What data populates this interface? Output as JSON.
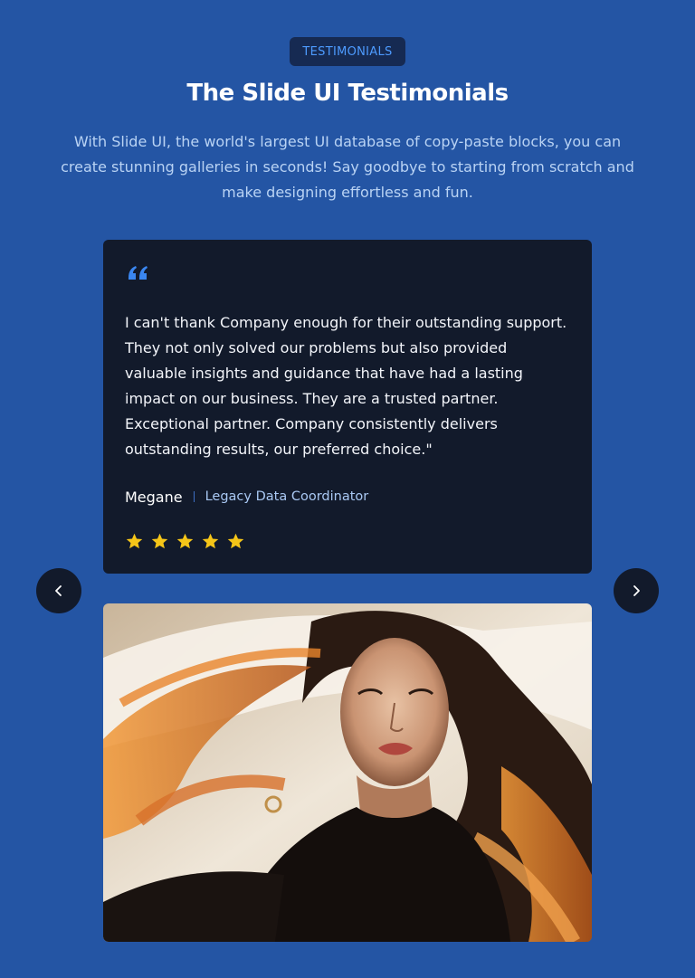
{
  "header": {
    "eyebrow": "TESTIMONIALS",
    "title": "The Slide UI Testimonials",
    "subtitle": "With Slide UI, the world's largest UI database of copy-paste blocks, you can create stunning galleries in seconds! Say goodbye to starting from scratch and make designing effortless and fun."
  },
  "testimonial": {
    "quote_icon": "quote-icon",
    "text": "I can't thank Company enough for their outstanding support. They not only solved our problems but also provided valuable insights and guidance that have had a lasting impact on our business. They are a trusted partner. Exceptional partner. Company consistently delivers outstanding results, our preferred choice.\"",
    "author": "Megane",
    "role": "Legacy Data Coordinator",
    "rating": 5,
    "rating_max": 5
  },
  "navigation": {
    "prev_icon": "chevron-left-icon",
    "next_icon": "chevron-right-icon"
  },
  "colors": {
    "background": "#2455a4",
    "card": "#121a2b",
    "accent": "#4d9bff",
    "star": "#f5c518"
  }
}
